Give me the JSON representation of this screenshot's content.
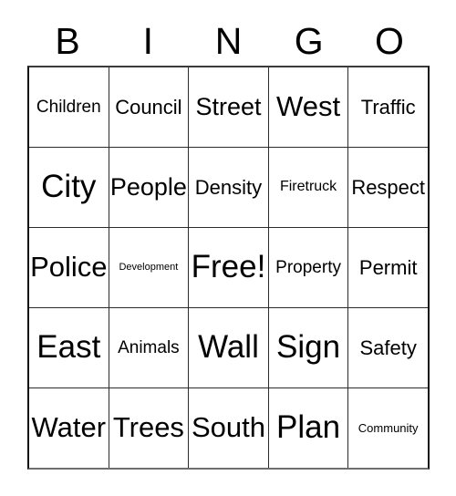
{
  "card": {
    "title": "BINGO",
    "header_letters": [
      "B",
      "I",
      "N",
      "G",
      "O"
    ],
    "free_space_label": "Free!",
    "grid_size": "5x5",
    "colors": {
      "background": "#ffffff",
      "text": "#000000",
      "border": "#2b2b2b"
    },
    "rows": [
      [
        {
          "label": "Children",
          "size": "fs-s"
        },
        {
          "label": "Council",
          "size": "fs-m"
        },
        {
          "label": "Street",
          "size": "fs-l"
        },
        {
          "label": "West",
          "size": "fs-xl"
        },
        {
          "label": "Traffic",
          "size": "fs-m"
        }
      ],
      [
        {
          "label": "City",
          "size": "fs-xxl"
        },
        {
          "label": "People",
          "size": "fs-l"
        },
        {
          "label": "Density",
          "size": "fs-m"
        },
        {
          "label": "Firetruck",
          "size": "fs-xs"
        },
        {
          "label": "Respect",
          "size": "fs-m"
        }
      ],
      [
        {
          "label": "Police",
          "size": "fs-xl"
        },
        {
          "label": "Development",
          "size": "fs-tiny"
        },
        {
          "label": "Free!",
          "size": "fs-xxl"
        },
        {
          "label": "Property",
          "size": "fs-s"
        },
        {
          "label": "Permit",
          "size": "fs-m"
        }
      ],
      [
        {
          "label": "East",
          "size": "fs-xxl"
        },
        {
          "label": "Animals",
          "size": "fs-s"
        },
        {
          "label": "Wall",
          "size": "fs-xxl"
        },
        {
          "label": "Sign",
          "size": "fs-xxl"
        },
        {
          "label": "Safety",
          "size": "fs-m"
        }
      ],
      [
        {
          "label": "Water",
          "size": "fs-xl"
        },
        {
          "label": "Trees",
          "size": "fs-xl"
        },
        {
          "label": "South",
          "size": "fs-xl"
        },
        {
          "label": "Plan",
          "size": "fs-xxl"
        },
        {
          "label": "Community",
          "size": "fs-xxs"
        }
      ]
    ]
  }
}
